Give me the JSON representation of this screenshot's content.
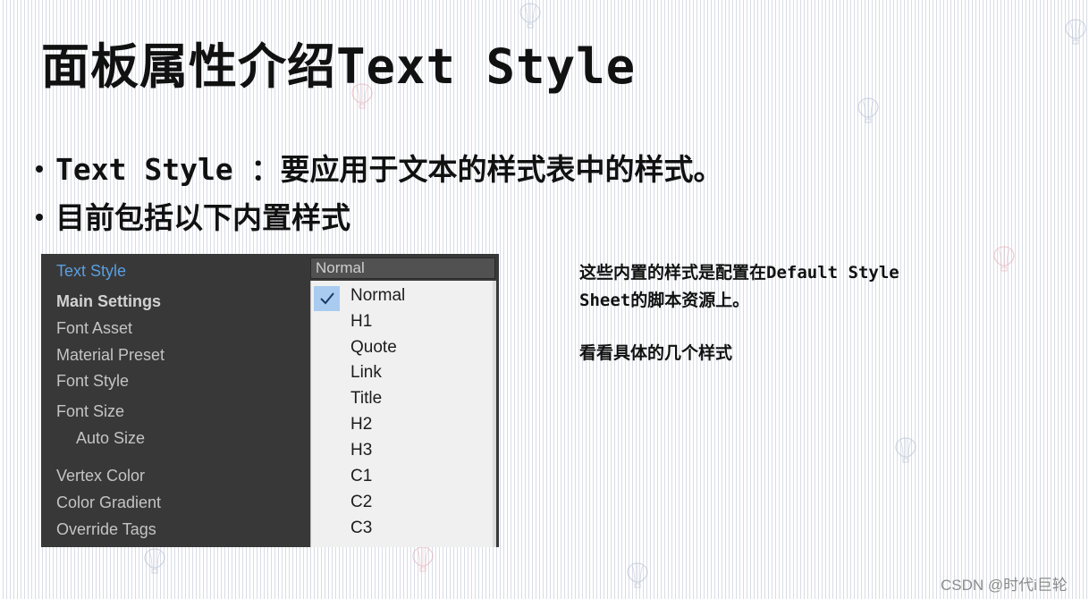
{
  "slide": {
    "title": "面板属性介绍Text Style",
    "bullets": [
      "Text Style ：要应用于文本的样式表中的样式。",
      "目前包括以下内置样式"
    ],
    "note": {
      "line1": "这些内置的样式是配置在Default Style",
      "line2": "Sheet的脚本资源上。",
      "line3": "看看具体的几个样式"
    },
    "watermark": "CSDN @时代i巨轮"
  },
  "inspector": {
    "rows": [
      "Text Style",
      "Main Settings",
      "Font Asset",
      "Material Preset",
      "Font Style",
      "Font Size",
      "Auto Size",
      "Vertex Color",
      "Color Gradient",
      "Override Tags"
    ],
    "dropdown": {
      "selected": "Normal",
      "options": [
        "Normal",
        "H1",
        "Quote",
        "Link",
        "Title",
        "H2",
        "H3",
        "C1",
        "C2",
        "C3"
      ]
    }
  },
  "colors": {
    "panel_bg": "#383838",
    "highlight_label": "#5a9fe0",
    "list_bg": "#f0f0f0",
    "selected_check_bg": "#a9cbf0"
  },
  "icons": {
    "check": "checkmark-icon",
    "decor": "hot-air-balloon-icon"
  }
}
